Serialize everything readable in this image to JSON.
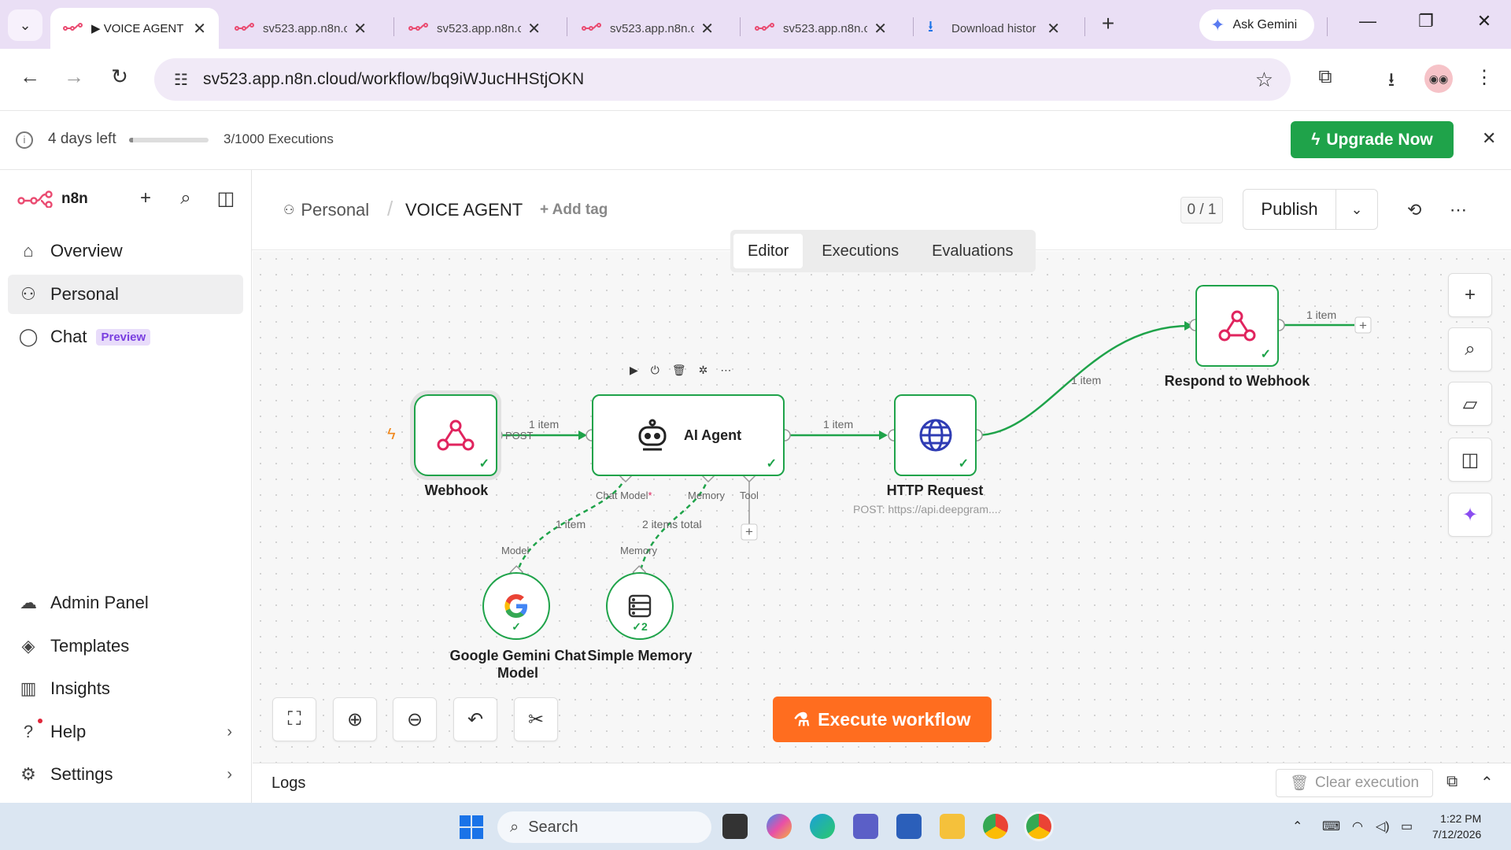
{
  "browser": {
    "tabs": [
      {
        "title": "▶ VOICE AGENT",
        "active": true
      },
      {
        "title": "sv523.app.n8n.cl",
        "active": false
      },
      {
        "title": "sv523.app.n8n.cl",
        "active": false
      },
      {
        "title": "sv523.app.n8n.cl",
        "active": false
      },
      {
        "title": "sv523.app.n8n.cl",
        "active": false
      },
      {
        "title": "Download histor",
        "active": false
      }
    ],
    "gemini_label": "Ask Gemini",
    "url": "sv523.app.n8n.cloud/workflow/bq9iWJucHHStjOKN"
  },
  "banner": {
    "days_left": "4 days left",
    "trial_progress": 0.05,
    "executions": "3/1000 Executions",
    "upgrade_label": "Upgrade Now"
  },
  "sidebar": {
    "logo": "n8n",
    "items": [
      {
        "label": "Overview",
        "icon": "home-icon"
      },
      {
        "label": "Personal",
        "icon": "user-icon",
        "active": true
      },
      {
        "label": "Chat",
        "icon": "chat-icon",
        "badge": "Preview"
      }
    ],
    "bottom_items": [
      {
        "label": "Admin Panel",
        "icon": "cloud-icon"
      },
      {
        "label": "Templates",
        "icon": "templates-icon"
      },
      {
        "label": "Insights",
        "icon": "insights-icon"
      },
      {
        "label": "Help",
        "icon": "help-icon"
      },
      {
        "label": "Settings",
        "icon": "settings-icon"
      }
    ]
  },
  "header": {
    "project": "Personal",
    "workflow_name": "VOICE AGENT",
    "add_tag": "+ Add tag",
    "counter": "0 / 1",
    "publish": "Publish"
  },
  "mode_tabs": [
    "Editor",
    "Executions",
    "Evaluations"
  ],
  "workflow": {
    "nodes": {
      "webhook": "Webhook",
      "ai_agent": "AI Agent",
      "http_request": "HTTP Request",
      "http_request_sub": "POST: https://api.deepgram....",
      "respond": "Respond to Webhook",
      "gemini_line1": "Google Gemini Chat",
      "gemini_line2": "Model",
      "memory": "Simple Memory",
      "memory_count": "2"
    },
    "wire_labels": {
      "webhook_agent": "1 item",
      "post": "POST",
      "agent_http": "1 item",
      "http_respond": "1 item",
      "respond_out": "1 item",
      "model_link": "1 item",
      "memory_link": "2 items total"
    },
    "ports": {
      "chat_model": "Chat Model",
      "required_mark": "*",
      "memory": "Memory",
      "tool": "Tool",
      "model_in": "Model",
      "memory_in": "Memory"
    }
  },
  "execute_label": "Execute workflow",
  "logs": {
    "title": "Logs",
    "clear": "Clear execution"
  },
  "taskbar": {
    "search": "Search",
    "time": "1:22 PM",
    "date": "7/12/2026"
  },
  "colors": {
    "success": "#1fa34a",
    "execute": "#ff6d1f",
    "webhook_icon": "#e0245e",
    "n8n_brand": "#ea4b71"
  }
}
